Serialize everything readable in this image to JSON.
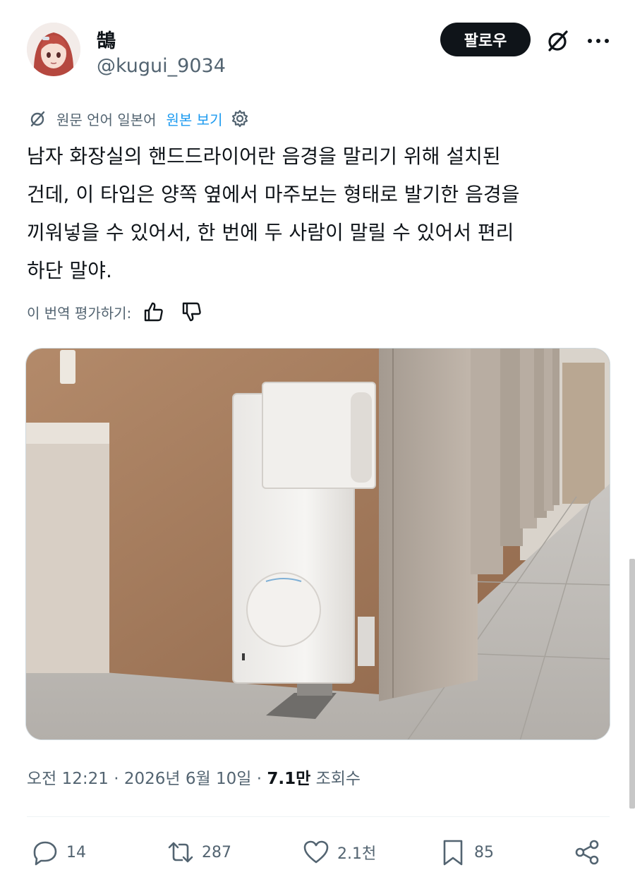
{
  "author": {
    "display_name": "鵠",
    "handle": "@kugui_9034",
    "follow_label": "팔로우"
  },
  "translation": {
    "notice": "원문 언어 일본어",
    "show_original": "원본 보기"
  },
  "tweet": {
    "lines": [
      "남자 화장실의 핸드드라이어란 음경을 말리기 위해 설치된",
      "건데, 이 타입은 양쪽 옆에서 마주보는 형태로 발기한 음경을",
      "끼워넣을 수 있어서, 한 번에 두 사람이 말릴 수 있어서 편리",
      "하단 말야."
    ]
  },
  "rating": {
    "label": "이 번역 평가하기:"
  },
  "meta": {
    "time": "오전 12:21",
    "date": "2026년 6월 10일",
    "views_count": "7.1만",
    "views_label": "조회수"
  },
  "stats": {
    "replies": "14",
    "retweets": "287",
    "likes": "2.1천",
    "bookmarks": "85"
  },
  "colors": {
    "accent": "#1d9bf0",
    "text_primary": "#0f1419",
    "text_secondary": "#536471"
  }
}
